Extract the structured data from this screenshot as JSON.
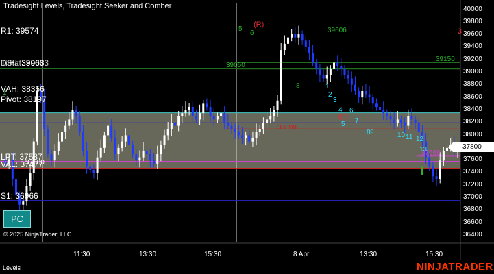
{
  "title": "Tradesight Levels, Tradesight Seeker and Comber",
  "copyright": "© 2025 NinjaTrader, LLC",
  "tab_label": "Levels",
  "brand": "NINJATRADER",
  "pc_button": "PC",
  "current_price": "37800",
  "level_labels": {
    "r1": "R1: 39574",
    "dstat": "DStat: 39063",
    "dstat_overlap": "TilHi: 39063",
    "vah": "VAH: 38356",
    "pivot": "Pivot: 38197",
    "lpt": "LPT: 37587",
    "val": "VAL: 37477",
    "val_overlap": "37500",
    "s1": "S1: 36966"
  },
  "chart_labels": {
    "r_marker": "(R)",
    "r_count": "3",
    "r_value": "39606",
    "green_39150": "39150",
    "green_39050": "39050",
    "red_38099": "38099",
    "p_marker": "(P)",
    "comber_37669": "37669",
    "green_1": "1",
    "green_5": "5",
    "green_6": "6",
    "green_8": "8"
  },
  "seeker_counts": [
    "1",
    "2",
    "3",
    "4",
    "5",
    "6",
    "7",
    "8",
    "9",
    "10",
    "11",
    "12",
    "13"
  ],
  "y_axis": [
    "40000",
    "39800",
    "39600",
    "39400",
    "39200",
    "39000",
    "38800",
    "38600",
    "38400",
    "38200",
    "38000",
    "37800",
    "37600",
    "37400",
    "37200",
    "37000",
    "36800",
    "36600",
    "36400"
  ],
  "x_axis": [
    "11:30",
    "13:30",
    "15:30",
    "8 Apr",
    "13:30",
    "15:30"
  ],
  "colors": {
    "background": "#000000",
    "up_bar": "#ffffff",
    "down_bar": "#1e3cff",
    "value_area": "#7a7a6a",
    "vah_line": "#3fc9c9",
    "pivot_line": "#2525cc",
    "r1_line": "#2525cc",
    "s1_line": "#2525cc",
    "dstat_line": "#1f6f1f",
    "red_line": "#d01a1a",
    "lpt_line": "#cc44cc",
    "seeker_text": "#2ee0ff",
    "comber_text": "#2bb02b",
    "brand": "#ff3300"
  },
  "chart_data": {
    "type": "candlestick",
    "title": "Tradesight Levels, Tradesight Seeker and Comber",
    "ylim": [
      36300,
      40100
    ],
    "x_ticks": [
      "11:30",
      "13:30",
      "15:30",
      "8 Apr",
      "13:30",
      "15:30"
    ],
    "levels": [
      {
        "name": "R1",
        "value": 39574
      },
      {
        "name": "DStat",
        "value": 39063
      },
      {
        "name": "VAH",
        "value": 38356
      },
      {
        "name": "Pivot",
        "value": 38197
      },
      {
        "name": "LPT",
        "value": 37587
      },
      {
        "name": "VAL",
        "value": 37477
      },
      {
        "name": "S1",
        "value": 36966
      }
    ],
    "annotations": [
      {
        "text": "39606",
        "value": 39606
      },
      {
        "text": "39150",
        "value": 39150
      },
      {
        "text": "39050",
        "value": 39050
      },
      {
        "text": "38099",
        "value": 38099
      },
      {
        "text": "37669",
        "value": 37669
      }
    ],
    "closes": [
      37550,
      37620,
      37300,
      37050,
      36900,
      36950,
      37200,
      37400,
      37900,
      38700,
      38600,
      38100,
      37700,
      37600,
      37750,
      37900,
      38050,
      38150,
      38250,
      38400,
      38300,
      38050,
      37750,
      37500,
      37450,
      37400,
      37650,
      37800,
      38000,
      38150,
      37950,
      37700,
      37800,
      37900,
      38000,
      37850,
      37700,
      37600,
      37650,
      37750,
      37700,
      37600,
      37550,
      37700,
      37850,
      38000,
      38100,
      38200,
      38150,
      38300,
      38350,
      38400,
      38450,
      38300,
      38250,
      38350,
      38500,
      38450,
      38300,
      38250,
      38300,
      38350,
      38200,
      38150,
      38100,
      38050,
      38000,
      37950,
      38000,
      37900,
      37950,
      38050,
      38100,
      38200,
      38250,
      38300,
      38400,
      38550,
      39350,
      39450,
      39550,
      39600,
      39550,
      39600,
      39500,
      39400,
      39300,
      39150,
      39050,
      38950,
      38900,
      38950,
      39050,
      39150,
      39100,
      39050,
      38950,
      38900,
      38800,
      38700,
      38600,
      38700,
      38650,
      38600,
      38500,
      38450,
      38400,
      38350,
      38300,
      38250,
      38200,
      38250,
      38200,
      38150,
      38300,
      38250,
      38200,
      38050,
      37900,
      37650,
      37500,
      37350,
      37300,
      37600,
      37750,
      37800,
      37850,
      37750,
      37800
    ]
  }
}
